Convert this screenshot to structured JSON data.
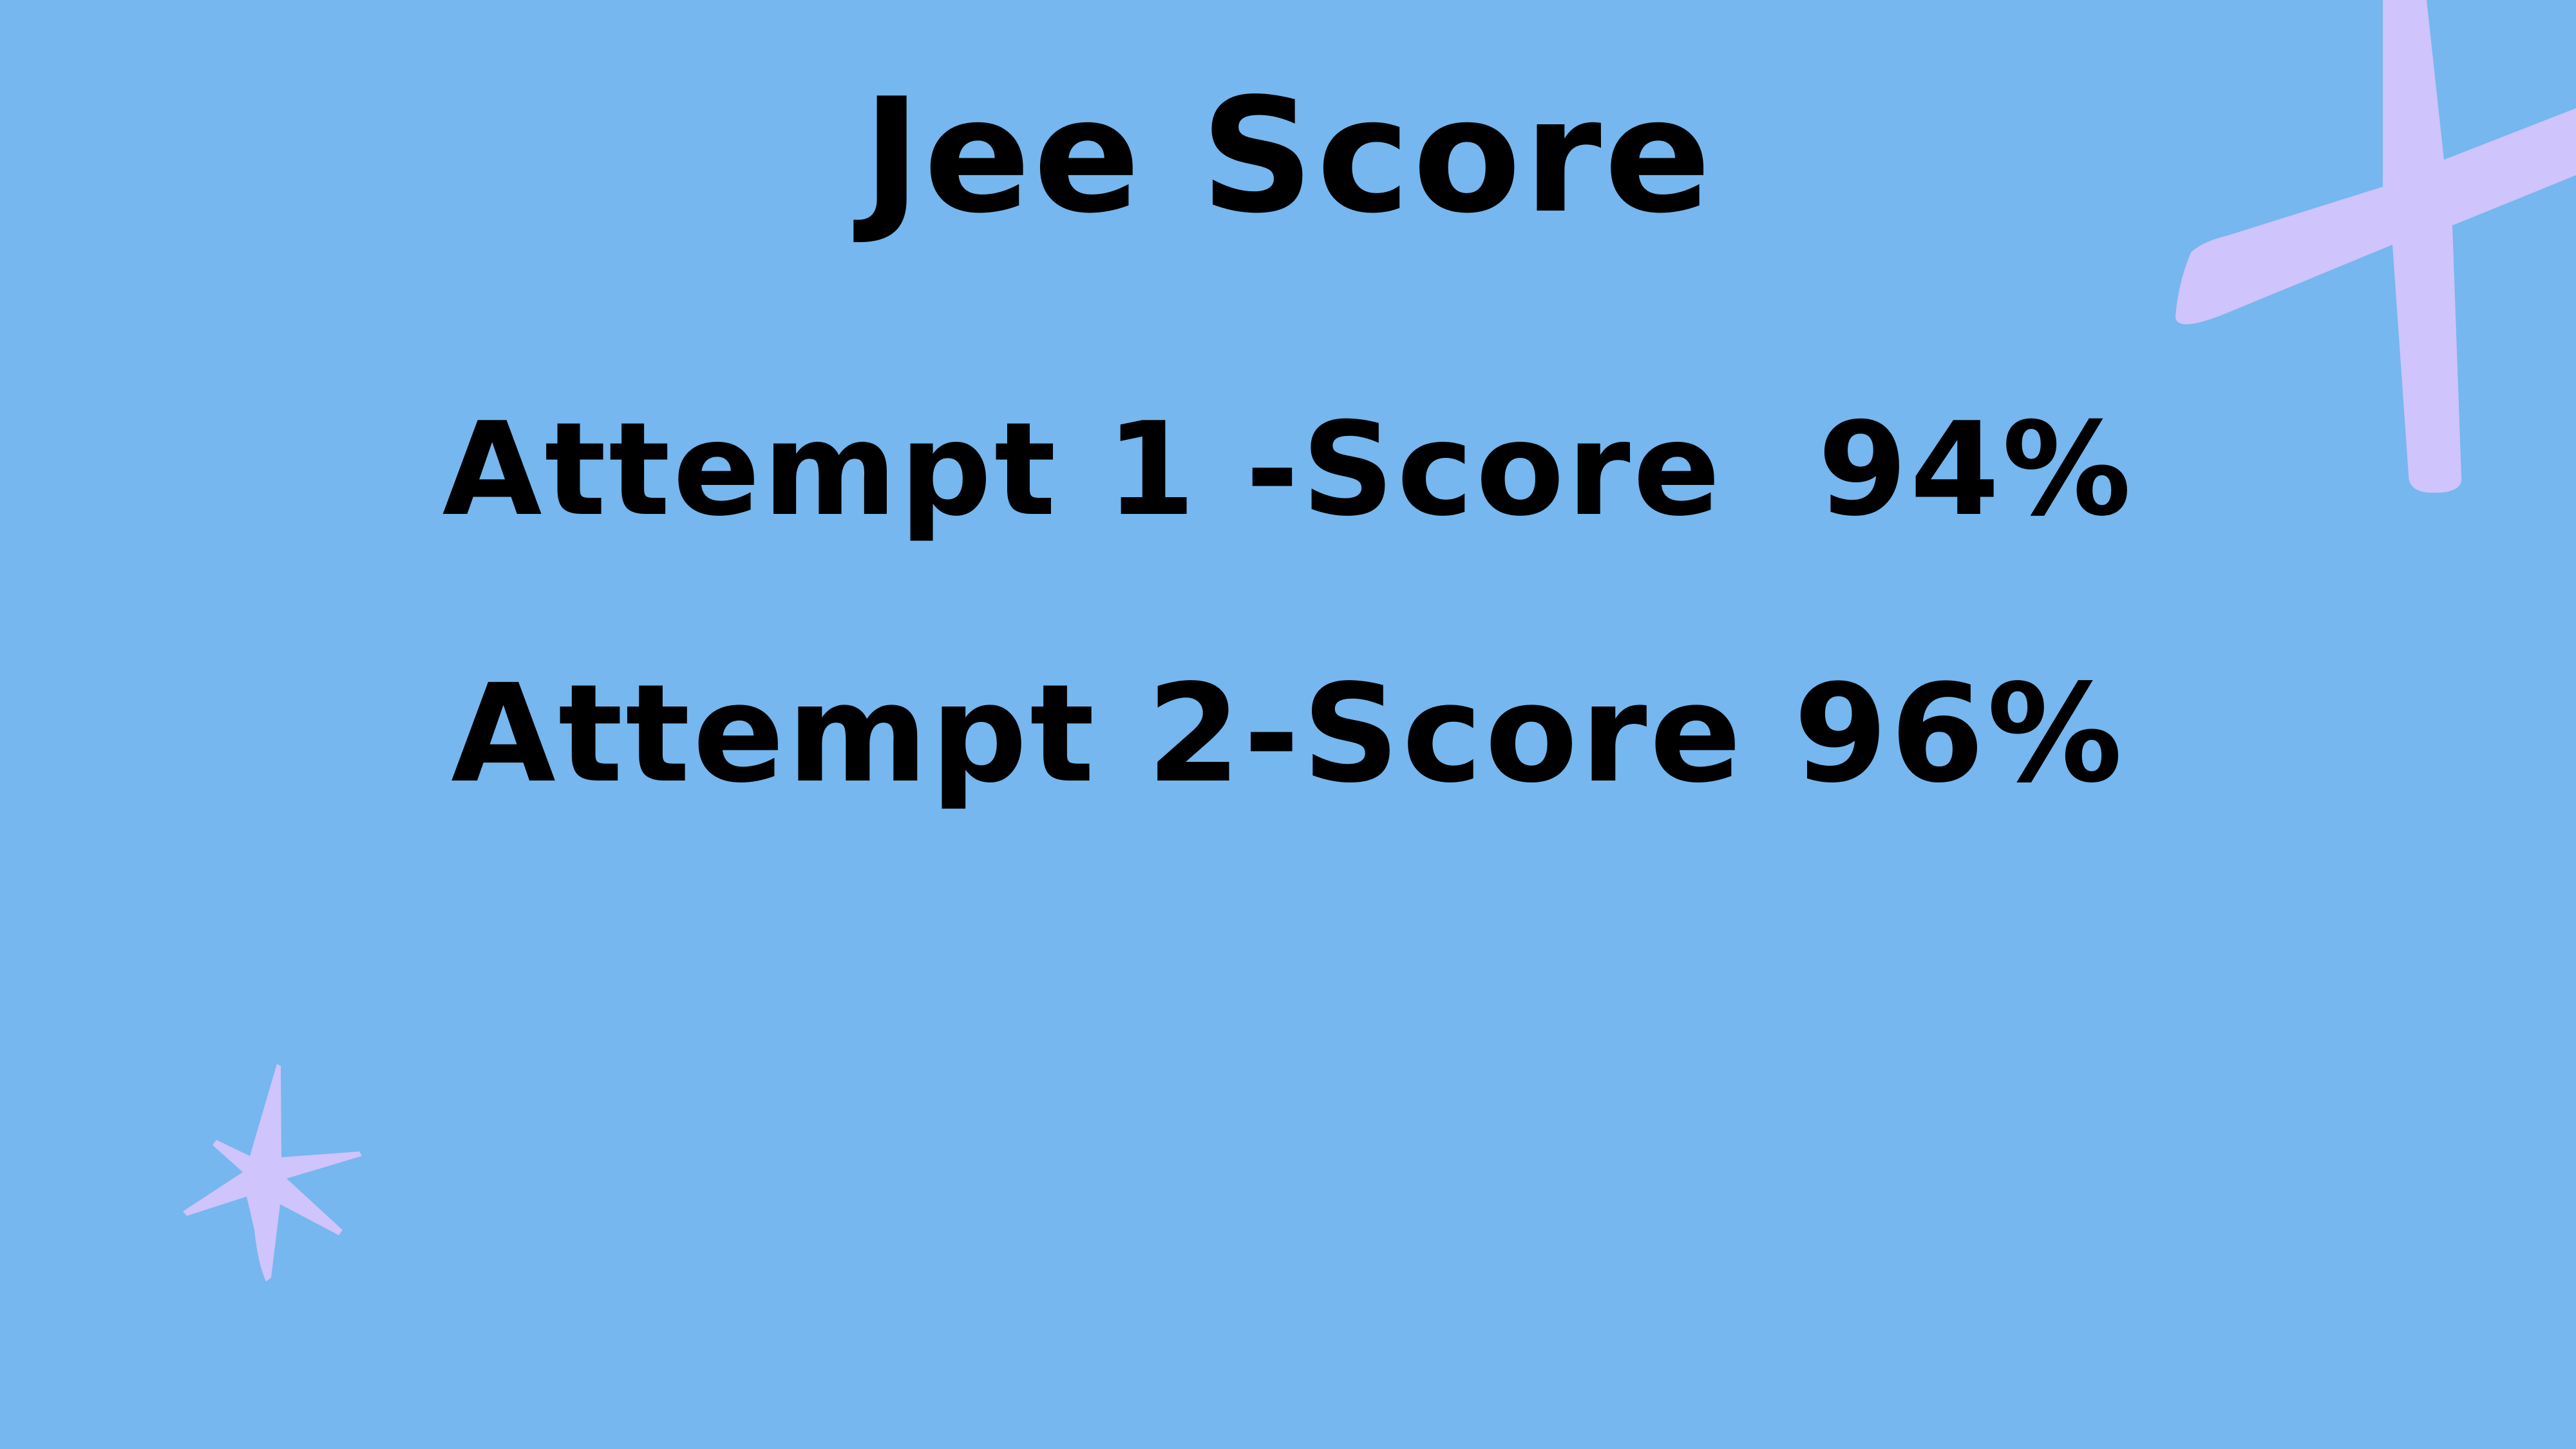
{
  "slide": {
    "title": "Jee Score",
    "attempts": [
      {
        "text": "Attempt 1 -Score  94%"
      },
      {
        "text": "Attempt 2-Score 96%"
      }
    ]
  },
  "colors": {
    "background": "#75b7ee",
    "text": "#000000",
    "sparkle": "#cfc4fb"
  },
  "decorations": [
    {
      "icon": "cross-sparkle-icon"
    },
    {
      "icon": "star-sparkle-icon"
    }
  ]
}
